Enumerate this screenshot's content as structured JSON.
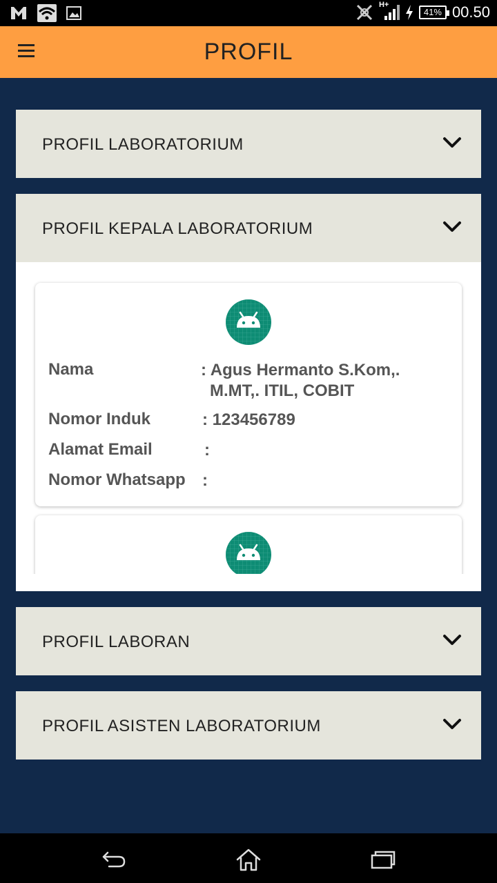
{
  "status_bar": {
    "network": "H+",
    "battery": "41%",
    "time": "00.50"
  },
  "app_bar": {
    "title": "PROFIL"
  },
  "sections": [
    {
      "label": "PROFIL LABORATORIUM",
      "expanded": false
    },
    {
      "label": "PROFIL KEPALA LABORATORIUM",
      "expanded": true
    },
    {
      "label": "PROFIL LABORAN",
      "expanded": false
    },
    {
      "label": "PROFIL ASISTEN LABORATORIUM",
      "expanded": false
    }
  ],
  "kepala_card": {
    "fields": [
      {
        "label": "Nama",
        "value": ": Agus Hermanto S.Kom,. M.MT,. ITIL, COBIT"
      },
      {
        "label": "Nomor Induk",
        "value": ": 123456789"
      },
      {
        "label": "Alamat Email",
        "value": ":"
      },
      {
        "label": "Nomor Whatsapp",
        "value": ":"
      }
    ]
  },
  "colors": {
    "app_bar": "#fe9e41",
    "background": "#11294a",
    "accordion_header": "#e5e5dc",
    "avatar": "#0e8c74"
  },
  "icons": {
    "menu": "hamburger-icon",
    "chevron": "chevron-down-icon",
    "avatar": "android-icon",
    "back": "back-icon",
    "home": "home-icon",
    "recents": "recents-icon"
  }
}
